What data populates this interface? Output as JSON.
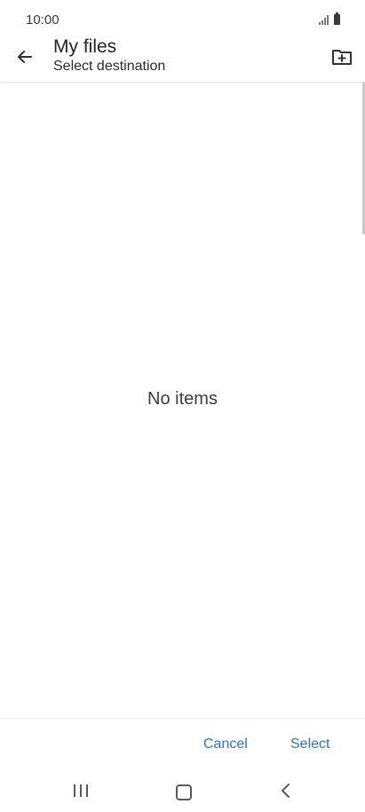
{
  "status_bar": {
    "time": "10:00",
    "icons": [
      "signal-icon",
      "battery-icon"
    ]
  },
  "app_bar": {
    "title": "My files",
    "subtitle": "Select destination",
    "back_icon": "back-arrow-icon",
    "new_folder_icon": "new-folder-icon"
  },
  "content": {
    "empty_message": "No items"
  },
  "actions": {
    "cancel_label": "Cancel",
    "select_label": "Select"
  },
  "nav_bar": {
    "icons": [
      "recents-icon",
      "home-icon",
      "back-icon"
    ]
  },
  "colors": {
    "accent": "#2f72c9",
    "text_primary": "#222222",
    "background": "#ffffff"
  }
}
